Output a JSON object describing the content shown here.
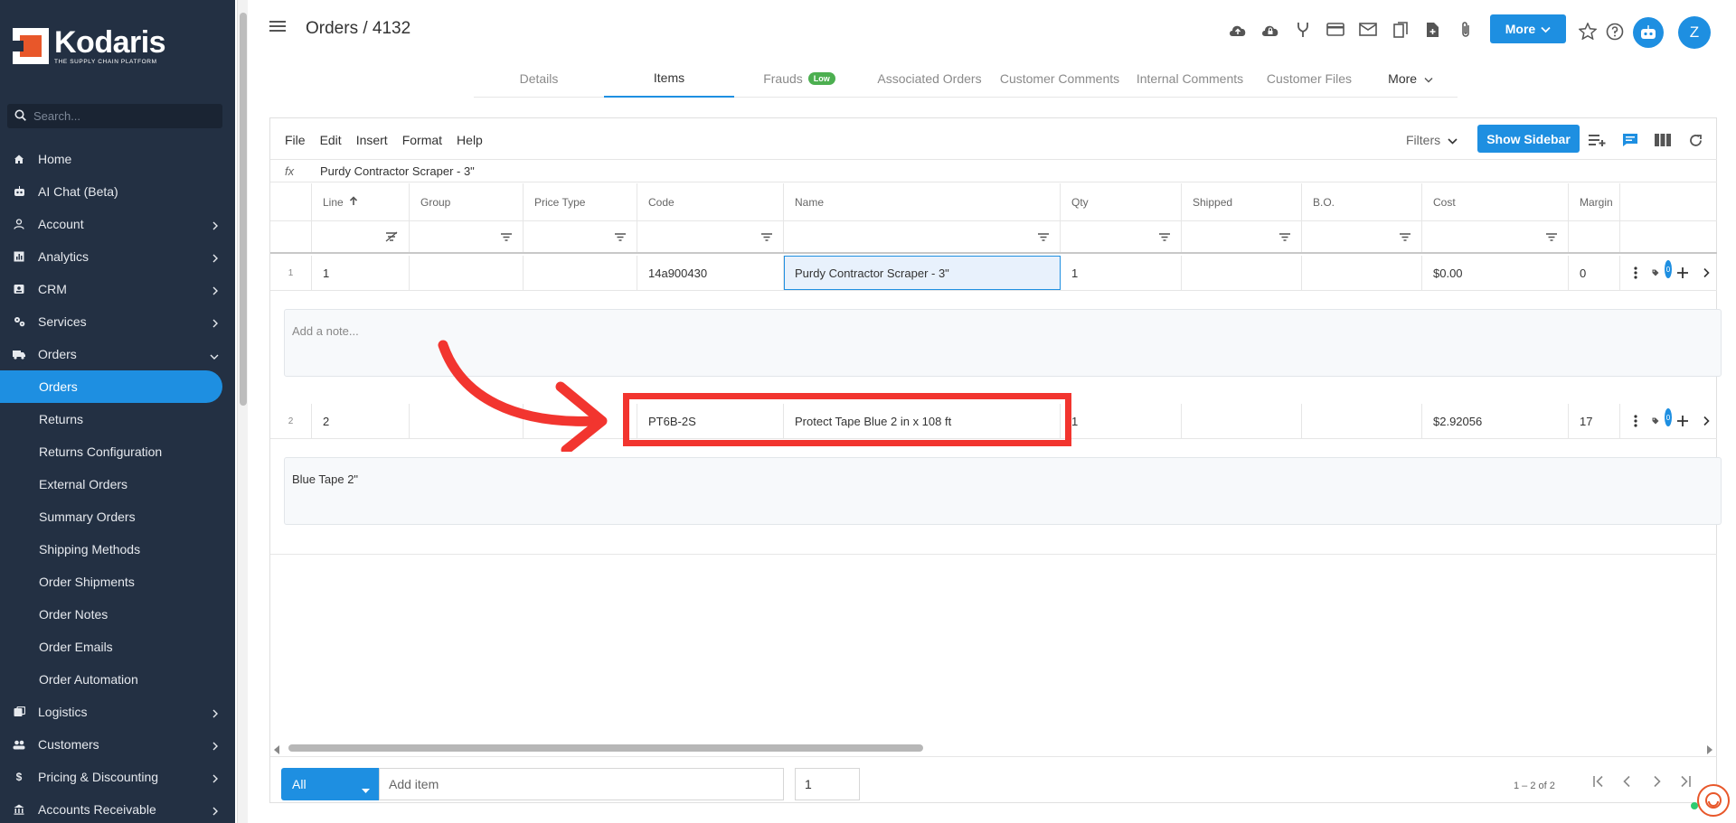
{
  "app": {
    "brand": "Kodaris",
    "tagline": "THE SUPPLY CHAIN PLATFORM",
    "page_title": "Orders / 4132",
    "avatar_letter": "Z",
    "more_label": "More"
  },
  "sidebar": {
    "search_placeholder": "Search...",
    "items": [
      {
        "label": "Home",
        "icon": "home-icon"
      },
      {
        "label": "AI Chat (Beta)",
        "icon": "robot-icon"
      },
      {
        "label": "Account",
        "icon": "person-icon"
      },
      {
        "label": "Analytics",
        "icon": "chart-icon"
      },
      {
        "label": "CRM",
        "icon": "contacts-icon"
      },
      {
        "label": "Services",
        "icon": "gears-icon"
      },
      {
        "label": "Orders",
        "icon": "truck-icon"
      },
      {
        "label": "Orders"
      },
      {
        "label": "Returns"
      },
      {
        "label": "Returns Configuration"
      },
      {
        "label": "External Orders"
      },
      {
        "label": "Summary Orders"
      },
      {
        "label": "Shipping Methods"
      },
      {
        "label": "Order Shipments"
      },
      {
        "label": "Order Notes"
      },
      {
        "label": "Order Emails"
      },
      {
        "label": "Order Automation"
      },
      {
        "label": "Logistics",
        "icon": "box-icon"
      },
      {
        "label": "Customers",
        "icon": "people-icon"
      },
      {
        "label": "Pricing & Discounting",
        "icon": "dollar-icon"
      },
      {
        "label": "Accounts Receivable",
        "icon": "bank-icon"
      }
    ]
  },
  "tabs": [
    {
      "label": "Details"
    },
    {
      "label": "Items"
    },
    {
      "label": "Frauds",
      "badge": "Low"
    },
    {
      "label": "Associated Orders"
    },
    {
      "label": "Customer Comments"
    },
    {
      "label": "Internal Comments"
    },
    {
      "label": "Customer Files"
    },
    {
      "label": "More"
    }
  ],
  "editor": {
    "menus": [
      "File",
      "Edit",
      "Insert",
      "Format",
      "Help"
    ],
    "filters_label": "Filters",
    "show_sidebar_label": "Show Sidebar",
    "fx_label": "fx",
    "fx_value": "Purdy Contractor Scraper - 3\""
  },
  "grid": {
    "columns": [
      "Line",
      "Group",
      "Price Type",
      "Code",
      "Name",
      "Qty",
      "Shipped",
      "B.O.",
      "Cost",
      "Margin"
    ],
    "rows": [
      {
        "rownum": "1",
        "line": "1",
        "group": "",
        "price_type": "",
        "code": "14a900430",
        "name": "Purdy Contractor Scraper - 3\"",
        "qty": "1",
        "shipped": "",
        "bo": "",
        "cost": "$0.00",
        "margin": "0",
        "note": "",
        "note_placeholder": "Add a note...",
        "badge": "0"
      },
      {
        "rownum": "2",
        "line": "2",
        "group": "",
        "price_type": "",
        "code": "PT6B-2S",
        "name": "Protect Tape Blue 2 in x 108 ft",
        "qty": "1",
        "shipped": "",
        "bo": "",
        "cost": "$2.92056",
        "margin": "17",
        "note": "Blue Tape 2\"",
        "badge": "0"
      }
    ]
  },
  "footer": {
    "scope": "All",
    "add_item_placeholder": "Add item",
    "qty_value": "1",
    "pager": "1 – 2 of 2"
  },
  "colors": {
    "sidebar_bg": "#233043",
    "accent": "#1e8fe1",
    "annotation": "#f2352f",
    "badge_low": "#4caf50"
  }
}
